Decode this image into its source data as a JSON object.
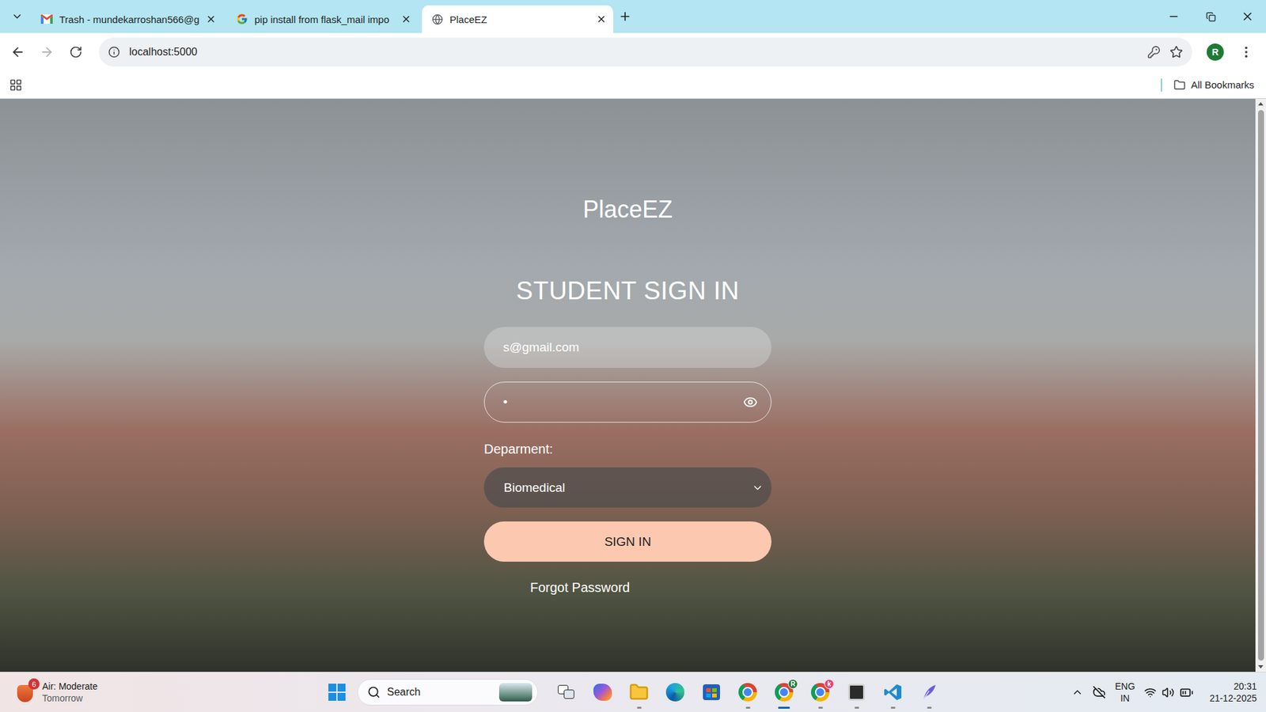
{
  "browser": {
    "tabs": [
      {
        "title": "Trash - mundekarroshan566@g",
        "selected": false,
        "kind": "gmail"
      },
      {
        "title": "pip install from flask_mail impo",
        "selected": false,
        "kind": "google"
      },
      {
        "title": "PlaceEZ",
        "selected": true,
        "kind": "globe"
      }
    ],
    "address": "localhost:5000",
    "forward_enabled": false,
    "profile_initial": "R",
    "bookmarks": {
      "folder": "All Bookmarks"
    }
  },
  "page": {
    "brand": "PlaceEZ",
    "heading": "STUDENT SIGN IN",
    "email": {
      "value": "s@gmail.com"
    },
    "password": {
      "value": "•"
    },
    "department": {
      "label": "Deparment:",
      "value": "Biomedical"
    },
    "submit": "SIGN IN",
    "forgot": "Forgot Password"
  },
  "taskbar": {
    "weather": {
      "badge": "6",
      "title": "Air: Moderate",
      "subtitle": "Tomorrow"
    },
    "search": {
      "placeholder": "Search"
    },
    "apps": [
      {
        "kind": "taskview",
        "running": false,
        "selected": false
      },
      {
        "kind": "copilot",
        "running": false,
        "selected": false
      },
      {
        "kind": "explorer",
        "running": true,
        "selected": false
      },
      {
        "kind": "edge",
        "running": false,
        "selected": false
      },
      {
        "kind": "store",
        "running": false,
        "selected": false
      },
      {
        "kind": "chrome",
        "running": true,
        "selected": false
      },
      {
        "kind": "chrome",
        "running": true,
        "selected": true,
        "badge": {
          "text": "R",
          "color": "#1e7b34"
        }
      },
      {
        "kind": "chrome",
        "running": true,
        "selected": false,
        "badge": {
          "text": "k",
          "color": "#e2457a"
        }
      },
      {
        "kind": "terminal",
        "running": true,
        "selected": false
      },
      {
        "kind": "vscode",
        "running": true,
        "selected": false
      },
      {
        "kind": "app",
        "running": true,
        "selected": false
      }
    ],
    "tray": {
      "language": "ENG",
      "region": "IN",
      "time": "20:31",
      "date": "21-12-2025"
    }
  }
}
